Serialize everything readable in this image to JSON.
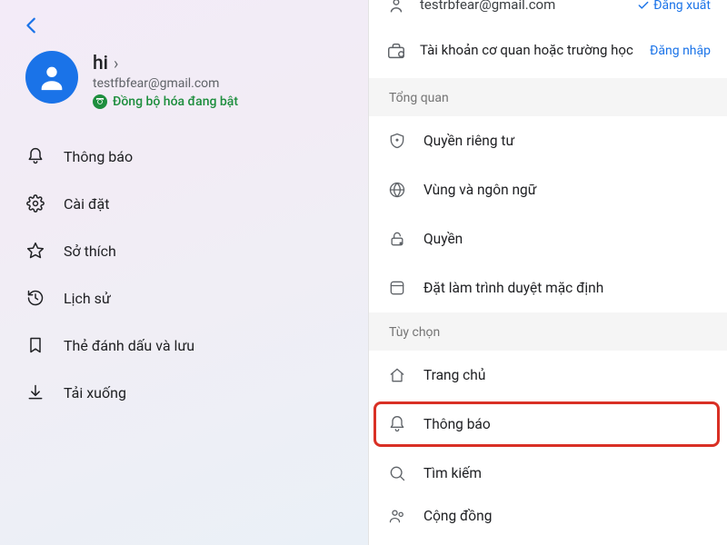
{
  "left": {
    "profile": {
      "name": "hi",
      "email": "testfbfear@gmail.com",
      "sync_status": "Đồng bộ hóa đang bật"
    },
    "menu": [
      {
        "id": "notifications",
        "label": "Thông báo",
        "icon": "bell-icon"
      },
      {
        "id": "settings",
        "label": "Cài đặt",
        "icon": "gear-icon"
      },
      {
        "id": "preferences",
        "label": "Sở thích",
        "icon": "star-icon"
      },
      {
        "id": "history",
        "label": "Lịch sử",
        "icon": "history-icon"
      },
      {
        "id": "bookmarks",
        "label": "Thẻ đánh dấu và lưu",
        "icon": "bookmark-icon"
      },
      {
        "id": "downloads",
        "label": "Tải xuống",
        "icon": "download-icon"
      }
    ]
  },
  "right": {
    "accounts": {
      "primary_email_partial": "testrbfear@gmail.com",
      "primary_action": "Đăng xuất",
      "work_school_label": "Tài khoản cơ quan hoặc trường học",
      "work_school_action": "Đăng nhập"
    },
    "sections": [
      {
        "id": "overview",
        "header": "Tổng quan",
        "items": [
          {
            "id": "privacy",
            "label": "Quyền riêng tư",
            "icon": "shield-icon"
          },
          {
            "id": "region",
            "label": "Vùng và ngôn ngữ",
            "icon": "globe-icon"
          },
          {
            "id": "perms",
            "label": "Quyền",
            "icon": "lock-icon"
          },
          {
            "id": "default",
            "label": "Đặt làm trình duyệt mặc định",
            "icon": "browser-icon"
          }
        ]
      },
      {
        "id": "options",
        "header": "Tùy chọn",
        "items": [
          {
            "id": "home",
            "label": "Trang chủ",
            "icon": "home-icon"
          },
          {
            "id": "notif",
            "label": "Thông báo",
            "icon": "bell-icon",
            "highlighted": true
          },
          {
            "id": "search",
            "label": "Tìm kiếm",
            "icon": "search-icon"
          },
          {
            "id": "community",
            "label": "Cộng đồng",
            "icon": "people-icon",
            "partial": true
          }
        ]
      }
    ]
  }
}
